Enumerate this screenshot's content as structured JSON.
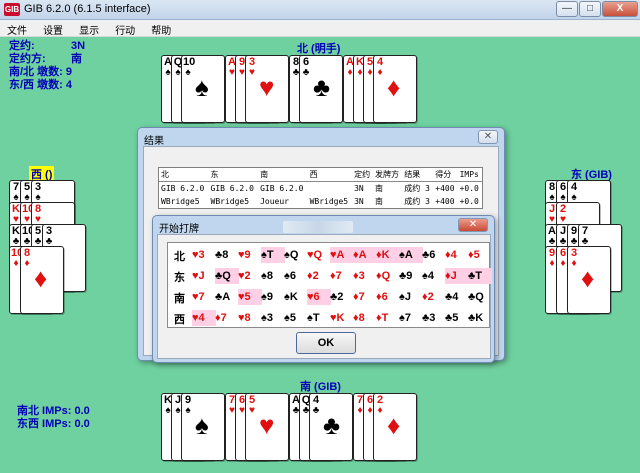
{
  "window": {
    "title": "GIB 6.2.0 (6.1.5 interface)",
    "icon_text": "GIB",
    "min": "—",
    "max": "□",
    "close": "X"
  },
  "menu": [
    "文件",
    "设置",
    "显示",
    "行动",
    "帮助"
  ],
  "contract_info": {
    "contract_label": "定约:",
    "contract_value": "3N",
    "declarer_label": "定约方:",
    "declarer_value": "南",
    "ns_tricks": "南/北 墩数: 9",
    "ew_tricks": "东/西 墩数: 4"
  },
  "seats": {
    "north": "北 (明手)",
    "west": "西 ()",
    "east": "东 (GIB)",
    "south": "南 (GIB)"
  },
  "imps": {
    "ns": "南北 IMPs: 0.0",
    "ew": "东西 IMPs: 0.0"
  },
  "hands": {
    "north": [
      {
        "rank": "A",
        "suit": "♠"
      },
      {
        "rank": "Q",
        "suit": "♠"
      },
      {
        "rank": "10",
        "suit": "♠"
      },
      {
        "rank": "A",
        "suit": "♥"
      },
      {
        "rank": "9",
        "suit": "♥"
      },
      {
        "rank": "3",
        "suit": "♥"
      },
      {
        "rank": "8",
        "suit": "♣"
      },
      {
        "rank": "6",
        "suit": "♣"
      },
      {
        "rank": "A",
        "suit": "♦"
      },
      {
        "rank": "K",
        "suit": "♦"
      },
      {
        "rank": "5",
        "suit": "♦"
      },
      {
        "rank": "4",
        "suit": "♦"
      }
    ],
    "west": [
      {
        "rank": "7",
        "suit": "♠"
      },
      {
        "rank": "5",
        "suit": "♠"
      },
      {
        "rank": "3",
        "suit": "♠"
      },
      {
        "rank": "K",
        "suit": "♥"
      },
      {
        "rank": "10",
        "suit": "♥"
      },
      {
        "rank": "8",
        "suit": "♥"
      },
      {
        "rank": "K",
        "suit": "♣"
      },
      {
        "rank": "10",
        "suit": "♣"
      },
      {
        "rank": "5",
        "suit": "♣"
      },
      {
        "rank": "3",
        "suit": "♣"
      },
      {
        "rank": "10",
        "suit": "♦"
      },
      {
        "rank": "8",
        "suit": "♦"
      }
    ],
    "east": [
      {
        "rank": "8",
        "suit": "♠"
      },
      {
        "rank": "6",
        "suit": "♠"
      },
      {
        "rank": "4",
        "suit": "♠"
      },
      {
        "rank": "J",
        "suit": "♥"
      },
      {
        "rank": "2",
        "suit": "♥"
      },
      {
        "rank": "A",
        "suit": "♣"
      },
      {
        "rank": "J",
        "suit": "♣"
      },
      {
        "rank": "9",
        "suit": "♣"
      },
      {
        "rank": "7",
        "suit": "♣"
      },
      {
        "rank": "9",
        "suit": "♦"
      },
      {
        "rank": "6",
        "suit": "♦"
      },
      {
        "rank": "3",
        "suit": "♦"
      }
    ],
    "south": [
      {
        "rank": "K",
        "suit": "♠"
      },
      {
        "rank": "J",
        "suit": "♠"
      },
      {
        "rank": "9",
        "suit": "♠"
      },
      {
        "rank": "7",
        "suit": "♥"
      },
      {
        "rank": "6",
        "suit": "♥"
      },
      {
        "rank": "5",
        "suit": "♥"
      },
      {
        "rank": "A",
        "suit": "♣"
      },
      {
        "rank": "Q",
        "suit": "♣"
      },
      {
        "rank": "4",
        "suit": "♣"
      },
      {
        "rank": "7",
        "suit": "♦"
      },
      {
        "rank": "6",
        "suit": "♦"
      },
      {
        "rank": "2",
        "suit": "♦"
      }
    ]
  },
  "result_dialog": {
    "title": "结果",
    "columns": [
      "北",
      "东",
      "南",
      "西",
      "定约",
      "发牌方",
      "结果",
      "得分",
      "IMPs"
    ],
    "rows": [
      [
        "GIB 6.2.0",
        "GIB 6.2.0",
        "GIB 6.2.0",
        "",
        "3N",
        "南",
        "成约 3",
        "+400",
        "+0.0"
      ],
      [
        "WBridge5",
        "WBridge5",
        "Joueur",
        "WBridge5",
        "3N",
        "南",
        "成约 3",
        "+400",
        "+0.0"
      ]
    ]
  },
  "play_dialog": {
    "title": "开始打牌",
    "ok_label": "OK",
    "rows": [
      {
        "seat": "北",
        "cards": [
          {
            "t": "♥3",
            "lead": false
          },
          {
            "t": "♣8",
            "lead": false
          },
          {
            "t": "♥9",
            "lead": false
          },
          {
            "t": "♠T",
            "lead": true
          },
          {
            "t": "♠Q",
            "lead": false
          },
          {
            "t": "♥Q",
            "lead": false
          },
          {
            "t": "♥A",
            "lead": true
          },
          {
            "t": "♦A",
            "lead": true
          },
          {
            "t": "♦K",
            "lead": true
          },
          {
            "t": "♠A",
            "lead": true
          },
          {
            "t": "♣6",
            "lead": false
          },
          {
            "t": "♦4",
            "lead": false
          },
          {
            "t": "♦5",
            "lead": false
          }
        ]
      },
      {
        "seat": "东",
        "cards": [
          {
            "t": "♥J",
            "lead": false
          },
          {
            "t": "♣Q",
            "lead": true
          },
          {
            "t": "♥2",
            "lead": false
          },
          {
            "t": "♠8",
            "lead": false
          },
          {
            "t": "♠6",
            "lead": false
          },
          {
            "t": "♦2",
            "lead": false
          },
          {
            "t": "♦7",
            "lead": false
          },
          {
            "t": "♦3",
            "lead": false
          },
          {
            "t": "♦Q",
            "lead": false
          },
          {
            "t": "♣9",
            "lead": false
          },
          {
            "t": "♠4",
            "lead": false
          },
          {
            "t": "♦J",
            "lead": true
          },
          {
            "t": "♣T",
            "lead": true
          }
        ]
      },
      {
        "seat": "南",
        "cards": [
          {
            "t": "♥7",
            "lead": false
          },
          {
            "t": "♣A",
            "lead": false
          },
          {
            "t": "♥5",
            "lead": true
          },
          {
            "t": "♠9",
            "lead": false
          },
          {
            "t": "♠K",
            "lead": false
          },
          {
            "t": "♥6",
            "lead": true
          },
          {
            "t": "♣2",
            "lead": false
          },
          {
            "t": "♦7",
            "lead": false
          },
          {
            "t": "♦6",
            "lead": false
          },
          {
            "t": "♠J",
            "lead": false
          },
          {
            "t": "♦2",
            "lead": false
          },
          {
            "t": "♣4",
            "lead": false
          },
          {
            "t": "♣Q",
            "lead": false
          }
        ]
      },
      {
        "seat": "西",
        "cards": [
          {
            "t": "♥4",
            "lead": true
          },
          {
            "t": "♦7",
            "lead": false
          },
          {
            "t": "♥8",
            "lead": false
          },
          {
            "t": "♠3",
            "lead": false
          },
          {
            "t": "♠5",
            "lead": false
          },
          {
            "t": "♠T",
            "lead": false
          },
          {
            "t": "♥K",
            "lead": false
          },
          {
            "t": "♦8",
            "lead": false
          },
          {
            "t": "♦T",
            "lead": false
          },
          {
            "t": "♠7",
            "lead": false
          },
          {
            "t": "♣3",
            "lead": false
          },
          {
            "t": "♣5",
            "lead": false
          },
          {
            "t": "♣K",
            "lead": false
          }
        ]
      }
    ]
  },
  "colors": {
    "table_green": "#6fd1a0",
    "label_blue": "#0000b8",
    "lead_pink": "#ffcfe6",
    "card_red": "#e01010"
  }
}
